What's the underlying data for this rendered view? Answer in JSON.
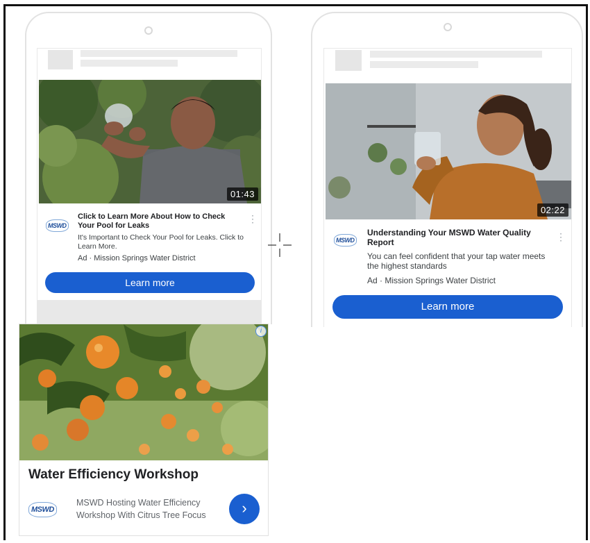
{
  "ad1": {
    "duration": "01:43",
    "logo_text": "MSWD",
    "title": "Click to Learn More About How to Check Your Pool for Leaks",
    "description": "It's Important to Check Your Pool for Leaks. Click to Learn More.",
    "meta": "Ad · Mission Springs Water District",
    "cta": "Learn more"
  },
  "ad2": {
    "duration": "02:22",
    "logo_text": "MSWD",
    "title": "Understanding Your MSWD Water Quality Report",
    "description": "You can feel confident that your tap water meets the highest standards",
    "meta": "Ad · Mission Springs Water District",
    "cta": "Learn more"
  },
  "display_ad": {
    "title": "Water Efficiency Workshop",
    "logo_text": "MSWD",
    "description": "MSWD Hosting Water Efficiency Workshop With Citrus Tree Focus",
    "info_icon": "i",
    "arrow": "›"
  },
  "colors": {
    "cta_blue": "#1a5fd0",
    "logo_blue": "#1e4e9a"
  },
  "icons": [
    "kebab-menu-icon",
    "info-icon",
    "chevron-right-icon",
    "crosshair-cursor-icon"
  ]
}
